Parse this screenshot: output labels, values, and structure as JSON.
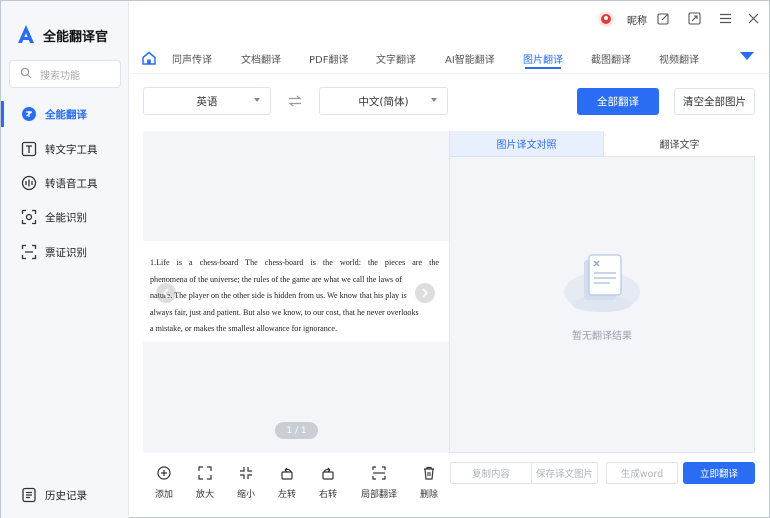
{
  "app": {
    "title": "全能翻译官"
  },
  "window_controls": {
    "user_name": "昵称"
  },
  "search": {
    "placeholder": "搜索功能"
  },
  "sidebar": {
    "items": [
      {
        "label": "全能翻译",
        "icon": "translate-icon",
        "active": true
      },
      {
        "label": "转文字工具",
        "icon": "text-tool-icon",
        "active": false
      },
      {
        "label": "转语音工具",
        "icon": "voice-tool-icon",
        "active": false
      },
      {
        "label": "全能识别",
        "icon": "recognize-icon",
        "active": false
      },
      {
        "label": "票证识别",
        "icon": "scan-ticket-icon",
        "active": false
      }
    ],
    "history_label": "历史记录"
  },
  "tabs": [
    {
      "label": "同声传译",
      "active": false
    },
    {
      "label": "文档翻译",
      "active": false
    },
    {
      "label": "PDF翻译",
      "active": false
    },
    {
      "label": "文字翻译",
      "active": false
    },
    {
      "label": "AI智能翻译",
      "active": false
    },
    {
      "label": "图片翻译",
      "active": true
    },
    {
      "label": "截图翻译",
      "active": false
    },
    {
      "label": "视频翻译",
      "active": false
    }
  ],
  "languages": {
    "source": "英语",
    "target": "中文(简体)"
  },
  "buttons": {
    "translate_all": "全部翻译",
    "clear_all": "清空全部图片"
  },
  "image": {
    "lines": [
      "1.Life is a chess-board The chess-board is the world: the pieces are the",
      "phenomena of the universe; the rules of the game are what we call the laws of",
      "nature. The player on the other side is hidden from us. We know that his play is",
      "always fair, just and patient. But also we know, to our cost, that he never overlooks",
      "a mistake, or makes the smallest allowance for ignorance."
    ],
    "page_indicator": "1 / 1"
  },
  "toolbar": [
    {
      "label": "添加",
      "icon": "add-icon"
    },
    {
      "label": "放大",
      "icon": "zoom-in-icon"
    },
    {
      "label": "缩小",
      "icon": "zoom-out-icon"
    },
    {
      "label": "左转",
      "icon": "rotate-left-icon"
    },
    {
      "label": "右转",
      "icon": "rotate-right-icon"
    },
    {
      "label": "局部翻译",
      "icon": "partial-translate-icon"
    },
    {
      "label": "删除",
      "icon": "trash-icon"
    }
  ],
  "result_tabs": {
    "compare": "图片译文对照",
    "text": "翻译文字"
  },
  "result": {
    "empty_text": "暂无翻译结果"
  },
  "actions": {
    "copy": "复制内容",
    "save": "保存译文图片",
    "generate": "生成word",
    "translate_now": "立即翻译"
  },
  "colors": {
    "accent": "#2a6df4",
    "sidebar_bg": "#f5f7fa",
    "panel_bg": "#f3f5f8"
  }
}
